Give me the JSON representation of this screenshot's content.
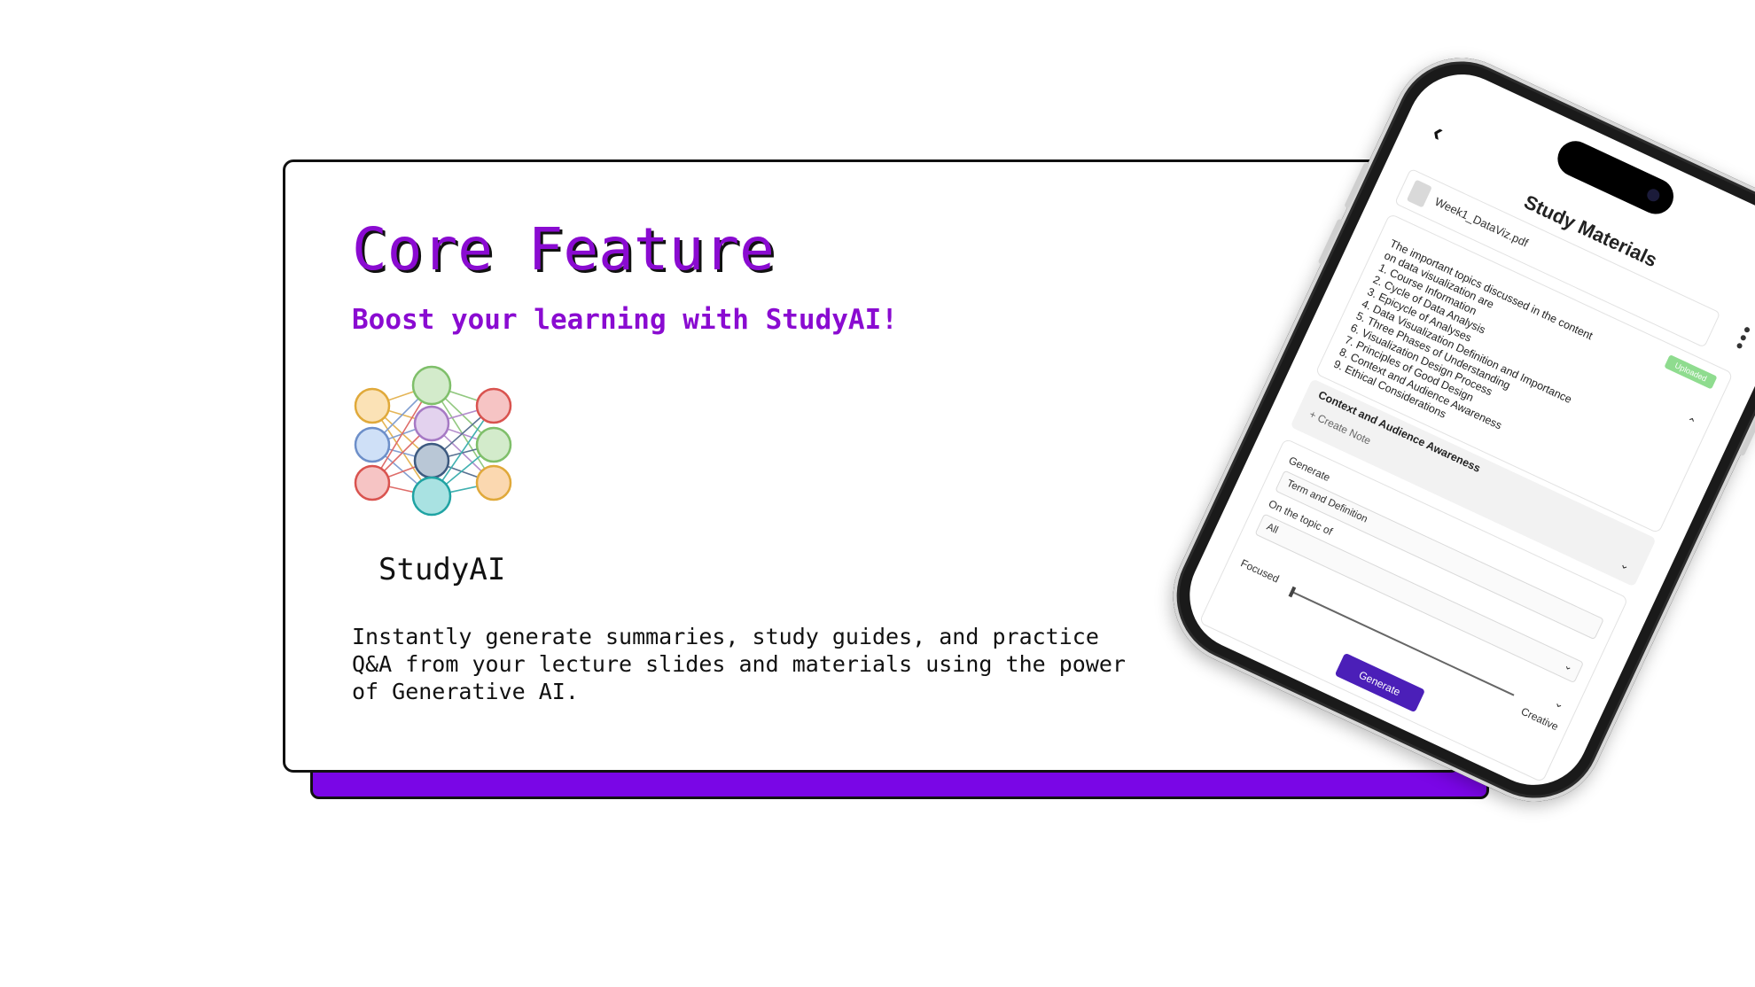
{
  "slide": {
    "title": "Core Feature",
    "subtitle": "Boost your learning with StudyAI!",
    "logo_text": "StudyAI",
    "description": "Instantly generate summaries, study guides, and practice Q&A from your lecture slides and materials using the power of Generative AI.",
    "colors": {
      "accent": "#8a0bd1",
      "shadow_card": "#7a06e6",
      "button": "#4b1fb8",
      "badge": "#8fdc8f"
    }
  },
  "phone": {
    "back_icon": "chevron-left-icon",
    "screen_title": "Study Materials",
    "menu_icon": "more-vertical-icon",
    "file_name": "Week1_DataViz.pdf",
    "badge": "Uploaded",
    "summary_lines": [
      "The important topics discussed in the content",
      "on data visualization are",
      "1. Course Information",
      "2. Cycle of Data Analysis",
      "3. Epicycle of Analyses",
      "4. Data Visualization Definition and Importance",
      "5. Three Phases of Understanding",
      "6. Visualization Design Process",
      "7. Principles of Good Design",
      "8. Context and Audience Awareness",
      "9. Ethical Considerations"
    ],
    "topic_title": "Context and Audience Awareness",
    "create_note": "+ Create Note",
    "generate_label": "Generate",
    "generate_value": "Term and Definition",
    "topic_label": "On the topic of",
    "topic_value": "All",
    "slider_min_label": "Focused",
    "slider_max_label": "Creative",
    "button_label": "Generate"
  }
}
